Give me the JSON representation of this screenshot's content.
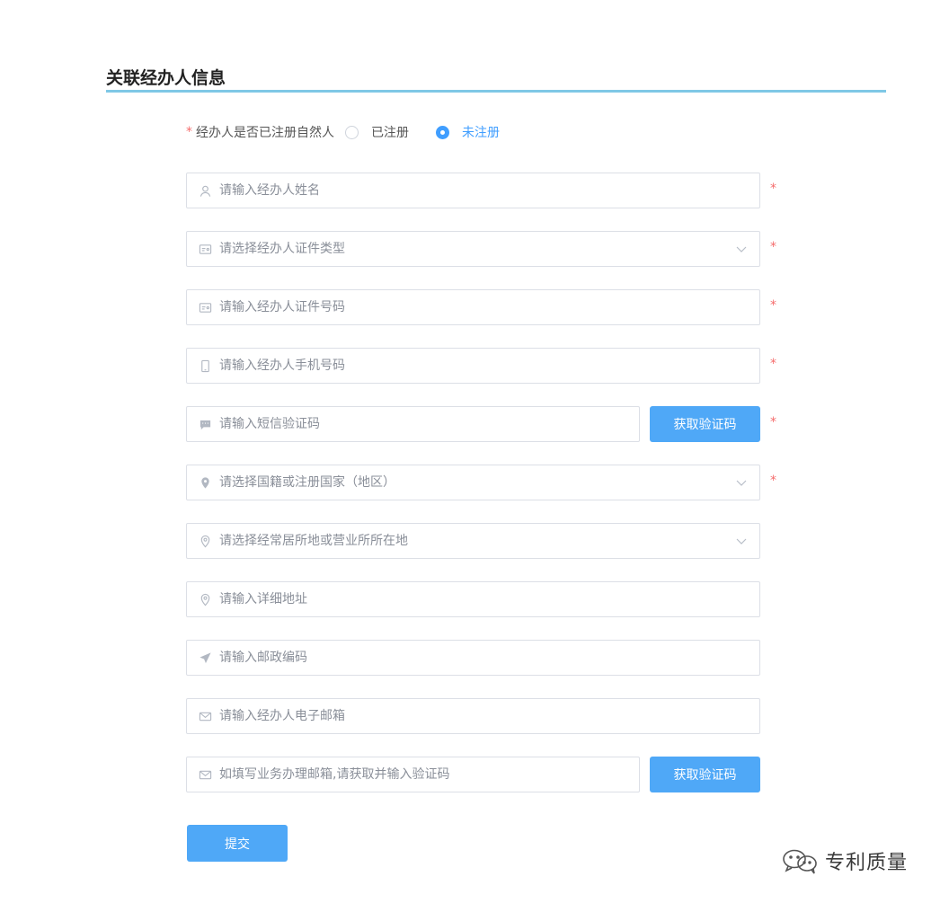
{
  "section": {
    "title": "关联经办人信息"
  },
  "registration": {
    "star": "*",
    "label": "经办人是否已注册自然人",
    "options": [
      {
        "label": "已注册",
        "checked": false
      },
      {
        "label": "未注册",
        "checked": true
      }
    ]
  },
  "fields": {
    "name": {
      "placeholder": "请输入经办人姓名",
      "value": "",
      "required": true,
      "icon": "user-icon"
    },
    "id_type": {
      "placeholder": "请选择经办人证件类型",
      "value": "",
      "required": true,
      "icon": "id-card-icon"
    },
    "id_number": {
      "placeholder": "请输入经办人证件号码",
      "value": "",
      "required": true,
      "icon": "id-card-icon"
    },
    "phone": {
      "placeholder": "请输入经办人手机号码",
      "value": "",
      "required": true,
      "icon": "phone-icon"
    },
    "sms_code": {
      "placeholder": "请输入短信验证码",
      "value": "",
      "required": true,
      "icon": "message-icon"
    },
    "nationality": {
      "placeholder": "请选择国籍或注册国家（地区）",
      "value": "",
      "required": true,
      "icon": "location-filled-icon"
    },
    "residence": {
      "placeholder": "请选择经常居所地或营业所所在地",
      "value": "",
      "required": false,
      "icon": "location-icon"
    },
    "address": {
      "placeholder": "请输入详细地址",
      "value": "",
      "required": false,
      "icon": "location-icon"
    },
    "postal": {
      "placeholder": "请输入邮政编码",
      "value": "",
      "required": false,
      "icon": "send-icon"
    },
    "email": {
      "placeholder": "请输入经办人电子邮箱",
      "value": "",
      "required": false,
      "icon": "mail-icon"
    },
    "biz_email": {
      "placeholder": "如填写业务办理邮箱,请获取并输入验证码",
      "value": "",
      "required": false,
      "icon": "mail-icon"
    }
  },
  "required_mark": "*",
  "buttons": {
    "get_sms_code": "获取验证码",
    "get_email_code": "获取验证码",
    "submit": "提交"
  },
  "watermark": {
    "text": "专利质量"
  },
  "colors": {
    "accent": "#409eff",
    "button": "#4fa8f7",
    "required": "#f56c6c",
    "section_line": "#7fc8e6"
  }
}
